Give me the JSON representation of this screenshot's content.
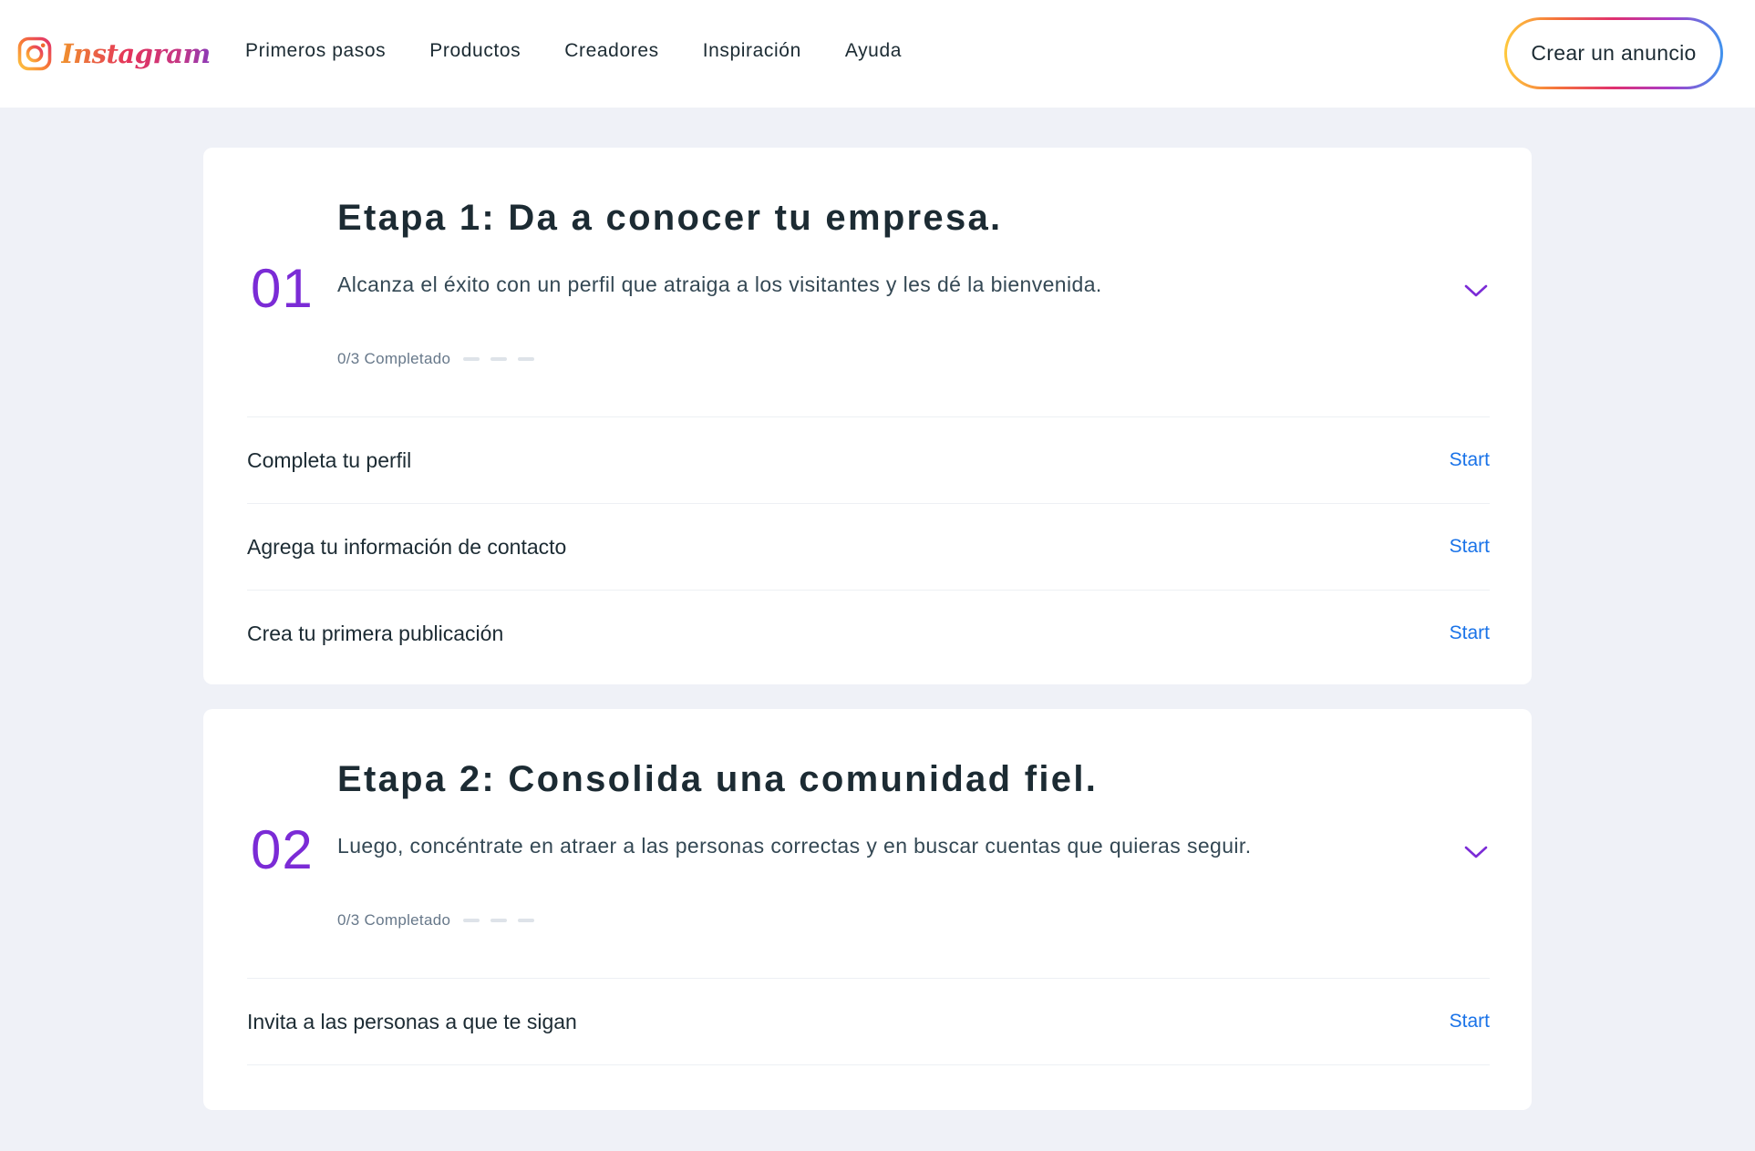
{
  "header": {
    "brand_name": "Instagram",
    "nav": [
      "Primeros pasos",
      "Productos",
      "Creadores",
      "Inspiración",
      "Ayuda"
    ],
    "cta_label": "Crear un anuncio"
  },
  "stages": [
    {
      "number": "01",
      "title": "Etapa 1: Da a conocer tu empresa.",
      "description": "Alcanza el éxito con un perfil que atraiga a los visitantes y les dé la bienvenida.",
      "progress_text": "0/3 Completado",
      "progress_completed": 0,
      "progress_total": 3,
      "tasks": [
        {
          "label": "Completa tu perfil",
          "action": "Start"
        },
        {
          "label": "Agrega tu información de contacto",
          "action": "Start"
        },
        {
          "label": "Crea tu primera publicación",
          "action": "Start"
        }
      ]
    },
    {
      "number": "02",
      "title": "Etapa 2: Consolida una comunidad fiel.",
      "description": "Luego, concéntrate en atraer a las personas correctas y en buscar cuentas que quieras seguir.",
      "progress_text": "0/3 Completado",
      "progress_completed": 0,
      "progress_total": 3,
      "tasks": [
        {
          "label": "Invita a las personas a que te sigan",
          "action": "Start"
        }
      ]
    }
  ],
  "colors": {
    "page_bg": "#eff1f7",
    "stage_number": "#7b2bd6",
    "start_link": "#1a73e8",
    "chevron": "#7b2bd6"
  },
  "icons": {
    "brand": "instagram-logo-icon",
    "expand": "chevron-down-icon"
  }
}
